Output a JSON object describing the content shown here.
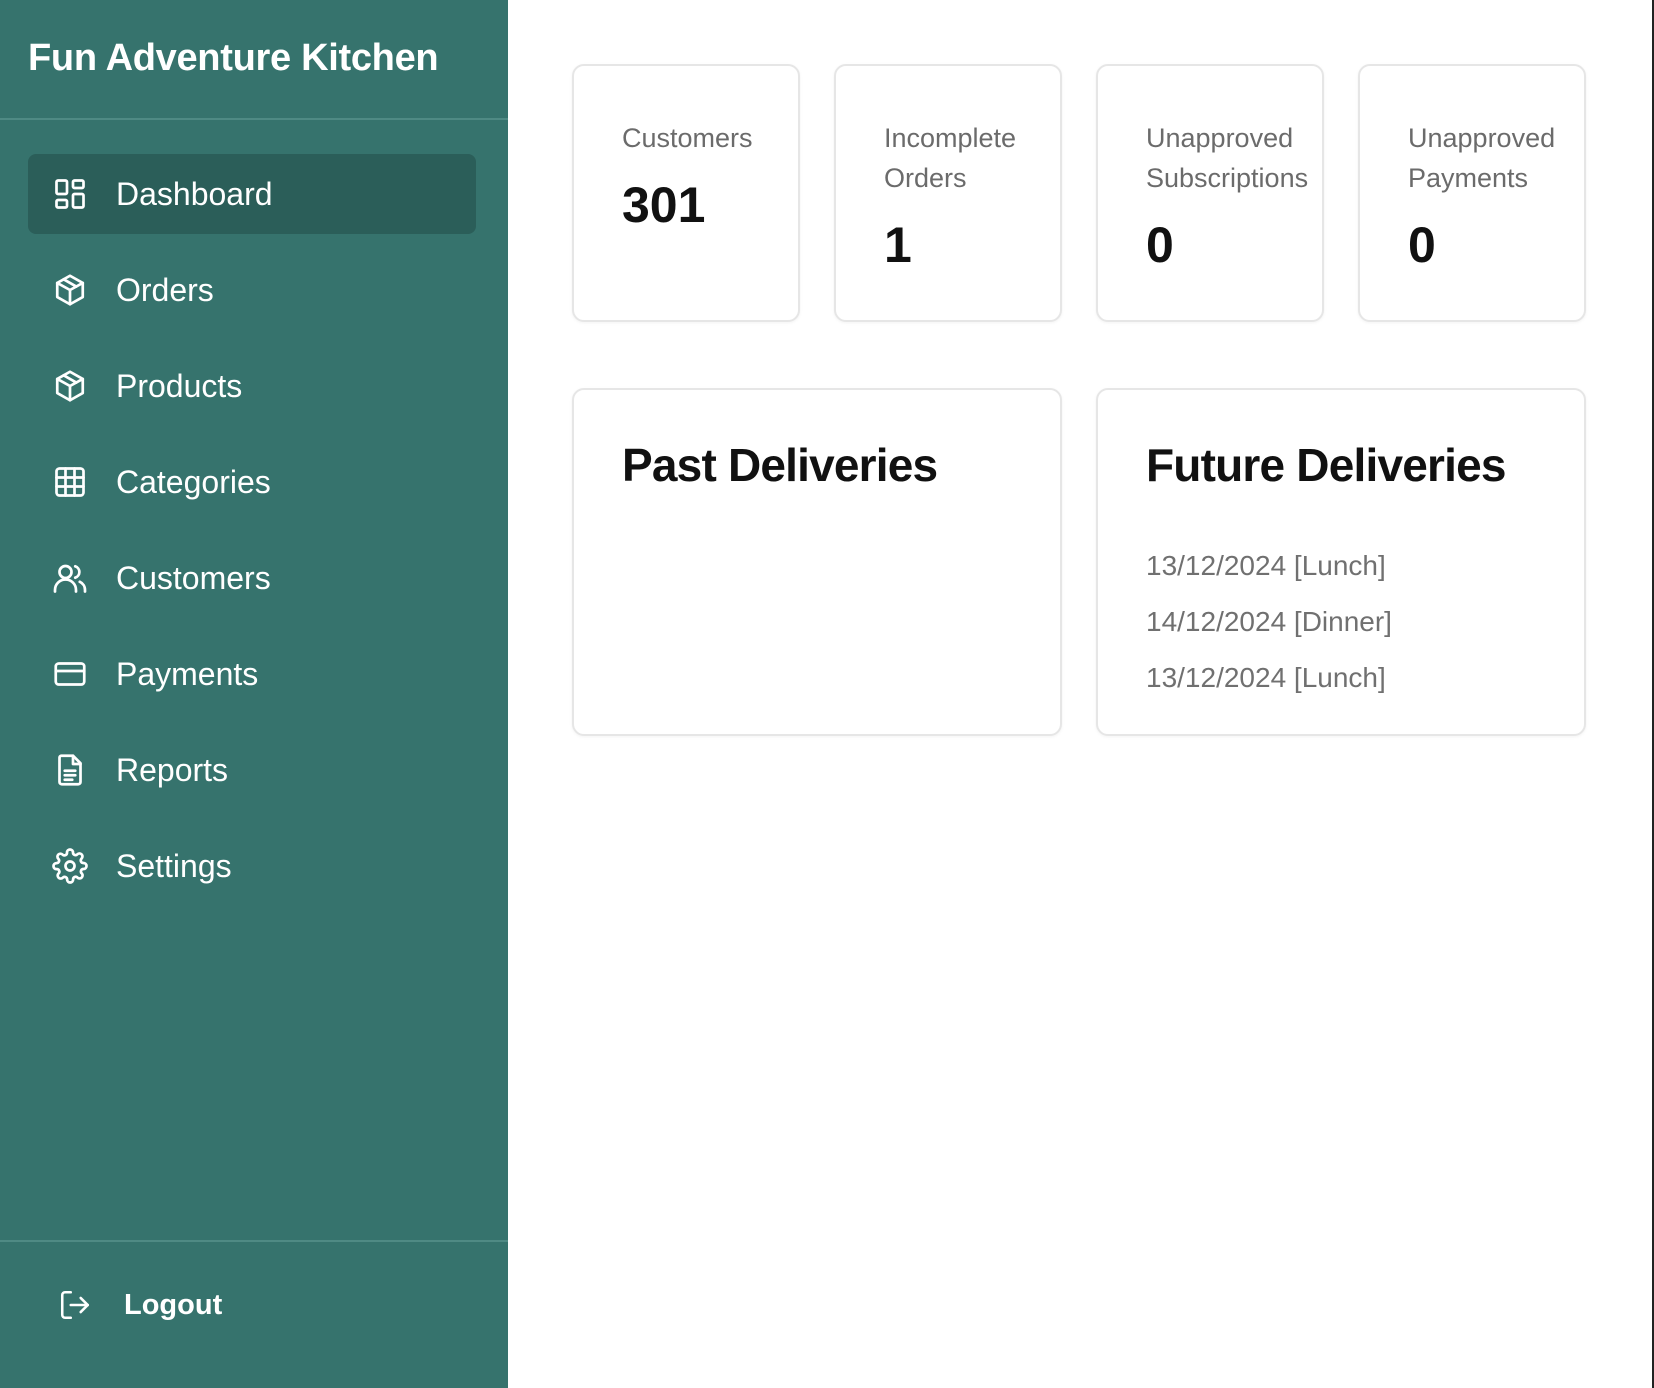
{
  "app": {
    "title": "Fun Adventure Kitchen"
  },
  "sidebar": {
    "items": [
      {
        "label": "Dashboard",
        "icon": "dashboard-icon",
        "active": true
      },
      {
        "label": "Orders",
        "icon": "package-icon",
        "active": false
      },
      {
        "label": "Products",
        "icon": "package-icon",
        "active": false
      },
      {
        "label": "Categories",
        "icon": "grid-icon",
        "active": false
      },
      {
        "label": "Customers",
        "icon": "users-icon",
        "active": false
      },
      {
        "label": "Payments",
        "icon": "credit-card-icon",
        "active": false
      },
      {
        "label": "Reports",
        "icon": "document-icon",
        "active": false
      },
      {
        "label": "Settings",
        "icon": "gear-icon",
        "active": false
      }
    ],
    "logout_label": "Logout",
    "logout_icon": "logout-icon"
  },
  "stats": [
    {
      "label": "Customers",
      "value": "301"
    },
    {
      "label": "Incomplete Orders",
      "value": "1"
    },
    {
      "label": "Unapproved Subscriptions",
      "value": "0"
    },
    {
      "label": "Unapproved Payments",
      "value": "0"
    }
  ],
  "past_deliveries": {
    "title": "Past Deliveries",
    "items": []
  },
  "future_deliveries": {
    "title": "Future Deliveries",
    "items": [
      "13/12/2024 [Lunch]",
      "14/12/2024 [Dinner]",
      "13/12/2024 [Lunch]"
    ]
  },
  "colors": {
    "sidebar_bg": "#36736d",
    "sidebar_active_bg": "#2b5e59",
    "card_border": "#e6e6e6",
    "muted_text": "#6b6b6b"
  }
}
